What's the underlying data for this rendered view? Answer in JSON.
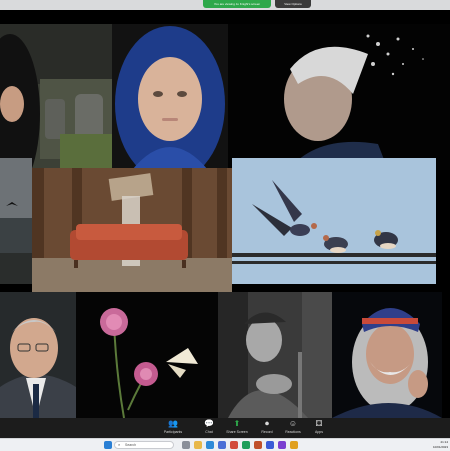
{
  "top_bar": {
    "share_notice": "You are viewing Jo Knight's screen",
    "view_options": "View Options"
  },
  "gallery": {
    "tiles": [
      {
        "subject": "woman-in-black-hood-graveyard"
      },
      {
        "subject": "girl-in-blue-headscarf"
      },
      {
        "subject": "elderly-woman-dispersion"
      },
      {
        "subject": "stormy-sea-seabird"
      },
      {
        "subject": "sofa-waterfall-room"
      },
      {
        "subject": "swallows-on-wire"
      },
      {
        "subject": "elderly-man-glasses"
      },
      {
        "subject": "pink-flowers-butterfly"
      },
      {
        "subject": "old-man-cap-bw"
      },
      {
        "subject": "man-white-beard-beanie"
      }
    ]
  },
  "meeting_controls": {
    "items": [
      {
        "label": "Participants",
        "icon": "participants-icon",
        "glyph": "👥"
      },
      {
        "label": "Chat",
        "icon": "chat-icon",
        "glyph": "💬"
      },
      {
        "label": "Share Screen",
        "icon": "share-screen-icon",
        "glyph": "⬆"
      },
      {
        "label": "Record",
        "icon": "record-icon",
        "glyph": "⏺"
      },
      {
        "label": "Reactions",
        "icon": "reactions-icon",
        "glyph": "☺"
      },
      {
        "label": "Apps",
        "icon": "apps-icon",
        "glyph": "⚃"
      }
    ]
  },
  "taskbar": {
    "search_placeholder": "Search",
    "time": "21:14",
    "date": "10/01/2023"
  },
  "colors": {
    "share_green": "#2ea84a",
    "taskbar_bg": "#eef0f3",
    "toolbar_bg": "#1c1c1c"
  }
}
